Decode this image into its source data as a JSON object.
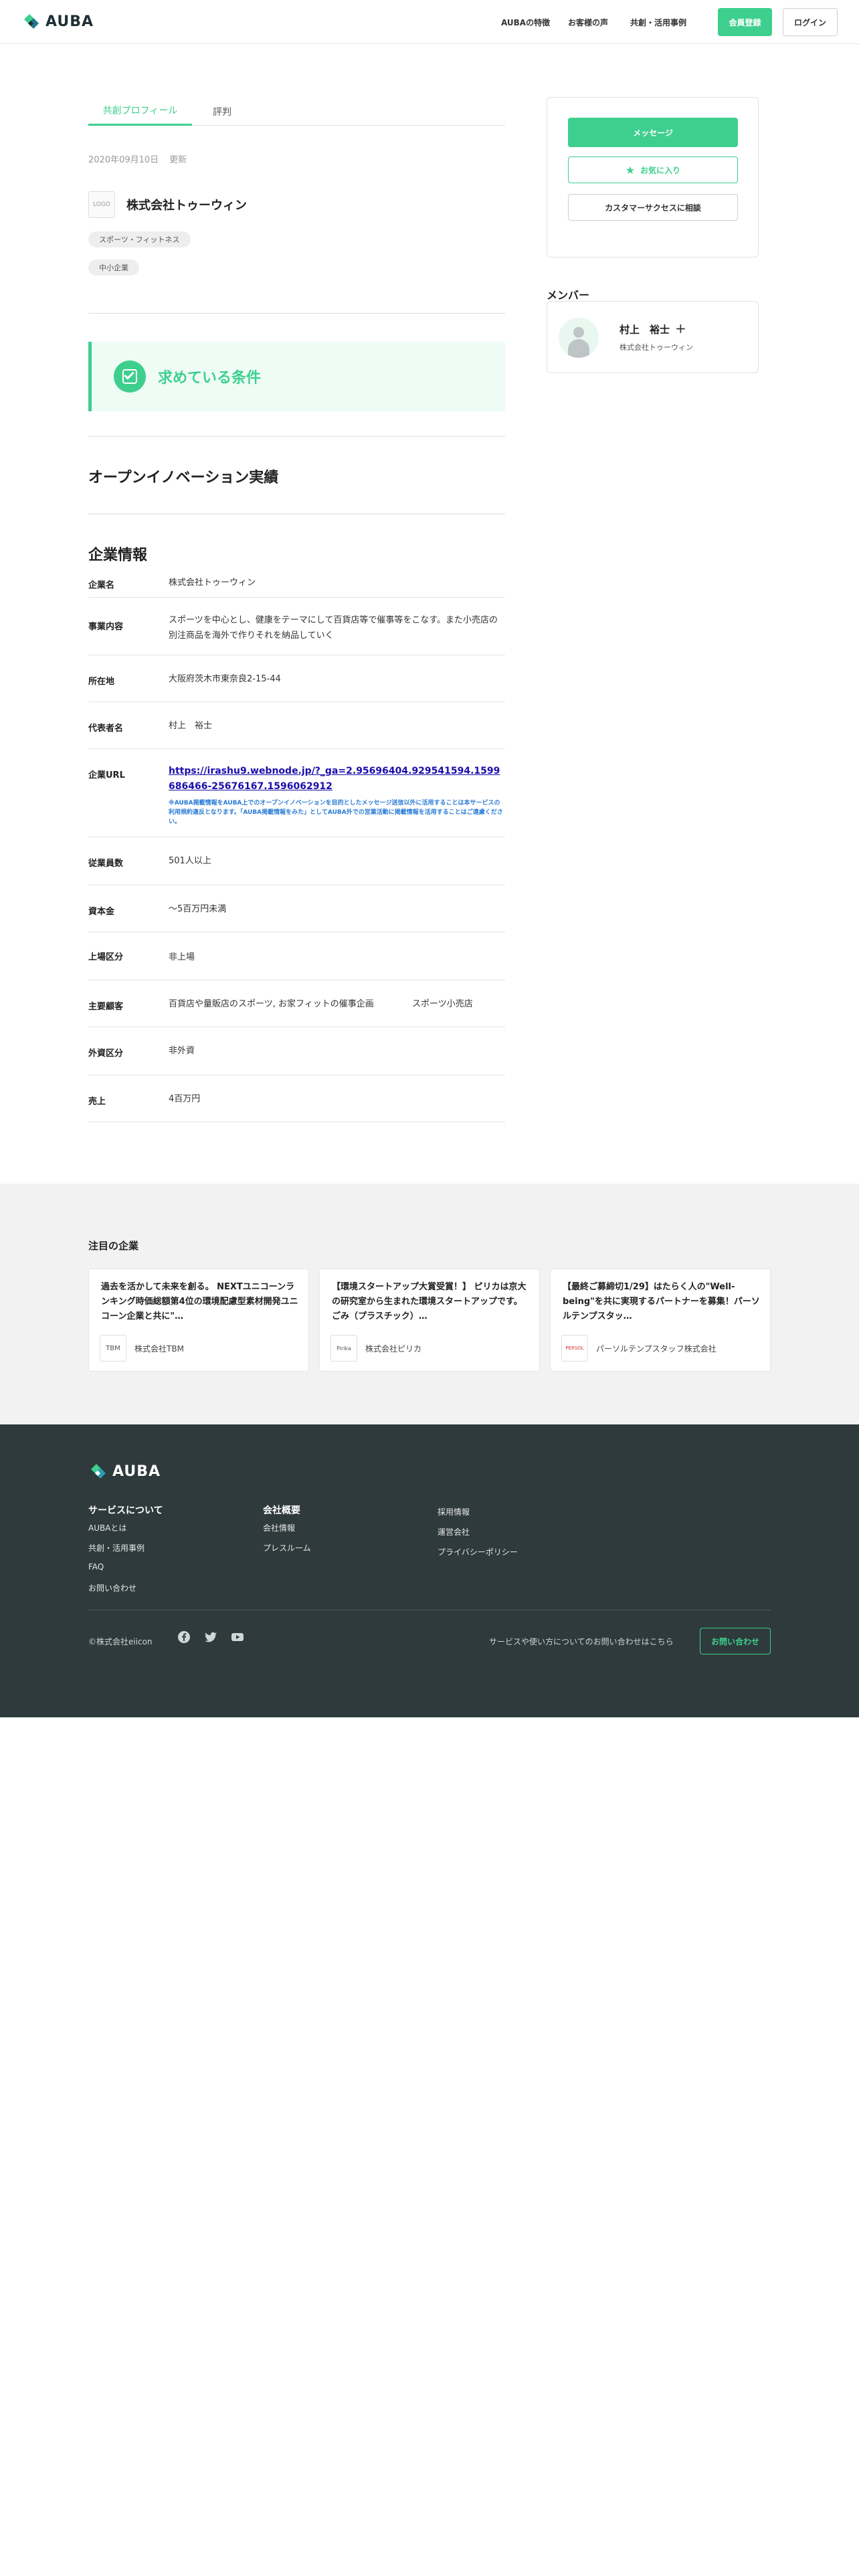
{
  "header": {
    "brand": "AUBA",
    "nav": [
      "AUBAの特徴",
      "お客様の声",
      "共創・活用事例"
    ],
    "register_label": "会員登録",
    "login_label": "ログイン"
  },
  "tabs": [
    "共創プロフィール",
    "評判"
  ],
  "meta": {
    "date": "2020年09月10日",
    "status": "更新"
  },
  "company": {
    "logo_text": "LOGO",
    "name": "株式会社トゥーウィン",
    "tags": [
      "スポーツ・フィットネス",
      "中小企業"
    ]
  },
  "conditions_title": "求めている条件",
  "innovation_title": "オープンイノベーション実績",
  "info": {
    "title": "企業情報",
    "rows": [
      {
        "label": "企業名",
        "value": "株式会社トゥーウィン"
      },
      {
        "label": "事業内容",
        "value": "スポーツを中心とし、健康をテーマにして百貨店等で催事等をこなす。また小売店の別注商品を海外で作りそれを納品していく"
      },
      {
        "label": "所在地",
        "value": "大阪府茨木市東奈良2-15-44"
      },
      {
        "label": "代表者名",
        "value": "村上　裕士"
      },
      {
        "label": "企業URL",
        "value": "https://irashu9.webnode.jp/?_ga=2.95696404.929541594.1599686466-25676167.1596062912",
        "note": "※AUBA掲載情報をAUBA上でのオープンイノベーションを目的としたメッセージ送信以外に活用することは本サービスの利用規約違反となります。「AUBA掲載情報をみた」としてAUBA外での営業活動に掲載情報を活用することはご遠慮ください。"
      },
      {
        "label": "従業員数",
        "value": "501人以上"
      },
      {
        "label": "資本金",
        "value": "〜5百万円未満"
      },
      {
        "label": "上場区分",
        "value": "非上場"
      },
      {
        "label": "主要顧客",
        "value": "百貨店や量販店のスポーツ, お家フィットの催事企画",
        "value2": "スポーツ小売店"
      },
      {
        "label": "外資区分",
        "value": "非外資"
      },
      {
        "label": "売上",
        "value": "4百万円"
      }
    ]
  },
  "sidebar": {
    "message_label": "メッセージ",
    "favorite_label": "お気に入り",
    "cs_label": "カスタマーサクセスに相談",
    "members_title": "メンバー",
    "member": {
      "name": "村上　裕士",
      "plus": "+",
      "company": "株式会社トゥーウィン"
    }
  },
  "featured": {
    "title": "注目の企業",
    "cards": [
      {
        "text": "過去を活かして未来を創る。 NEXTユニコーンランキング時価総額第4位の環境配慮型素材開発ユニコーン企業と共に\"…",
        "logo": "TBM",
        "company": "株式会社TBM"
      },
      {
        "text": "【環境スタートアップ大賞受賞！】 ピリカは京大の研究室から生まれた環境スタートアップです。 ごみ（プラスチック）…",
        "logo": "Pirika",
        "company": "株式会社ピリカ"
      },
      {
        "text": "【最終ご募締切1/29】はたらく人の\"Well-being\"を共に実現するパートナーを募集！パーソルテンプスタッ…",
        "logo": "PERSOL",
        "company": "パーソルテンプスタッフ株式会社"
      }
    ]
  },
  "footer": {
    "brand": "AUBA",
    "col1_title": "サービスについて",
    "col1_links": [
      "AUBAとは",
      "共創・活用事例",
      "FAQ",
      "お問い合わせ"
    ],
    "col2_title": "会社概要",
    "col2_links": [
      "会社情報",
      "プレスルーム"
    ],
    "col3_links": [
      "採用情報",
      "運営会社",
      "プライバシーポリシー"
    ],
    "copyright": "©株式会社eiicon",
    "contact_text": "サービスや使い方についてのお問い合わせはこちら",
    "contact_button": "お問い合わせ"
  },
  "colors": {
    "accent": "#3ecf8e",
    "footer_bg": "#2e3a3b",
    "link": "#1a0dab",
    "note": "#2a7bd6"
  }
}
